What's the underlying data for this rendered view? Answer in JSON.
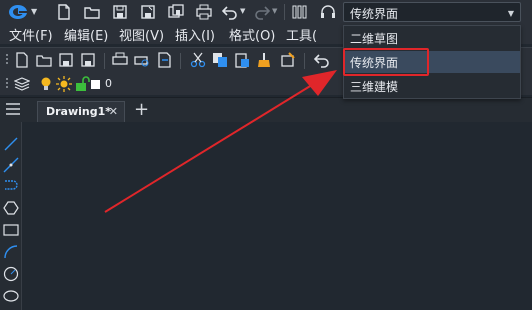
{
  "workspace": {
    "current": "传统界面",
    "options": [
      "二维草图",
      "传统界面",
      "三维建模"
    ],
    "selected_index": 1
  },
  "menubar": {
    "items": [
      "文件(F)",
      "编辑(E)",
      "视图(V)",
      "插入(I)",
      "格式(O)",
      "工具("
    ]
  },
  "layer": {
    "name": "0"
  },
  "tabs": [
    {
      "label": "Drawing1*"
    }
  ],
  "colors": {
    "annotation_red": "#e0262a",
    "selected_bg": "#3a4a5e",
    "logo_blue": "#2f8ff0"
  },
  "icons": {
    "quick_access": [
      "new-file-icon",
      "open-folder-icon",
      "save-icon",
      "save-as-icon",
      "save-all-icon",
      "print-icon",
      "undo-icon",
      "redo-icon",
      "toolbar-bars-icon",
      "headset-icon"
    ],
    "draw_tools": [
      "line-icon",
      "construction-line-icon",
      "polyline-icon",
      "polygon-icon",
      "rectangle-icon",
      "arc-icon",
      "circle-icon",
      "cloud-icon"
    ]
  }
}
